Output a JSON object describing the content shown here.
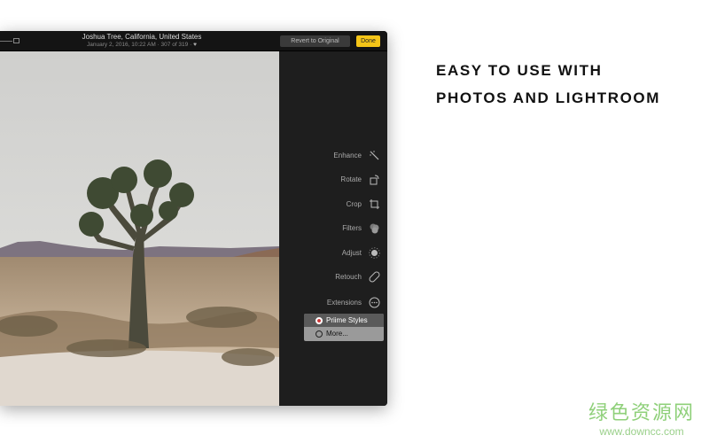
{
  "toolbar": {
    "title": "Joshua Tree, California, United States",
    "date": "January 2, 2016, 10:22 AM",
    "separator": "·",
    "count": "307 of 319",
    "revert_label": "Revert to Original",
    "done_label": "Done"
  },
  "tools": [
    {
      "label": "Enhance",
      "icon": "magic-wand-icon"
    },
    {
      "label": "Rotate",
      "icon": "rotate-icon"
    },
    {
      "label": "Crop",
      "icon": "crop-icon"
    },
    {
      "label": "Filters",
      "icon": "filters-icon"
    },
    {
      "label": "Adjust",
      "icon": "adjust-icon"
    },
    {
      "label": "Retouch",
      "icon": "bandage-icon"
    },
    {
      "label": "Extensions",
      "icon": "more-icon"
    }
  ],
  "extensions_menu": [
    {
      "label": "Priime Styles"
    },
    {
      "label": "More..."
    }
  ],
  "headline": {
    "line1": "EASY TO USE WITH",
    "line2": "PHOTOS AND LIGHTROOM"
  },
  "watermark": {
    "line1": "绿色资源网",
    "line2": "www.downcc.com"
  },
  "colors": {
    "done": "#f5c518",
    "window": "#1e1e1e"
  }
}
